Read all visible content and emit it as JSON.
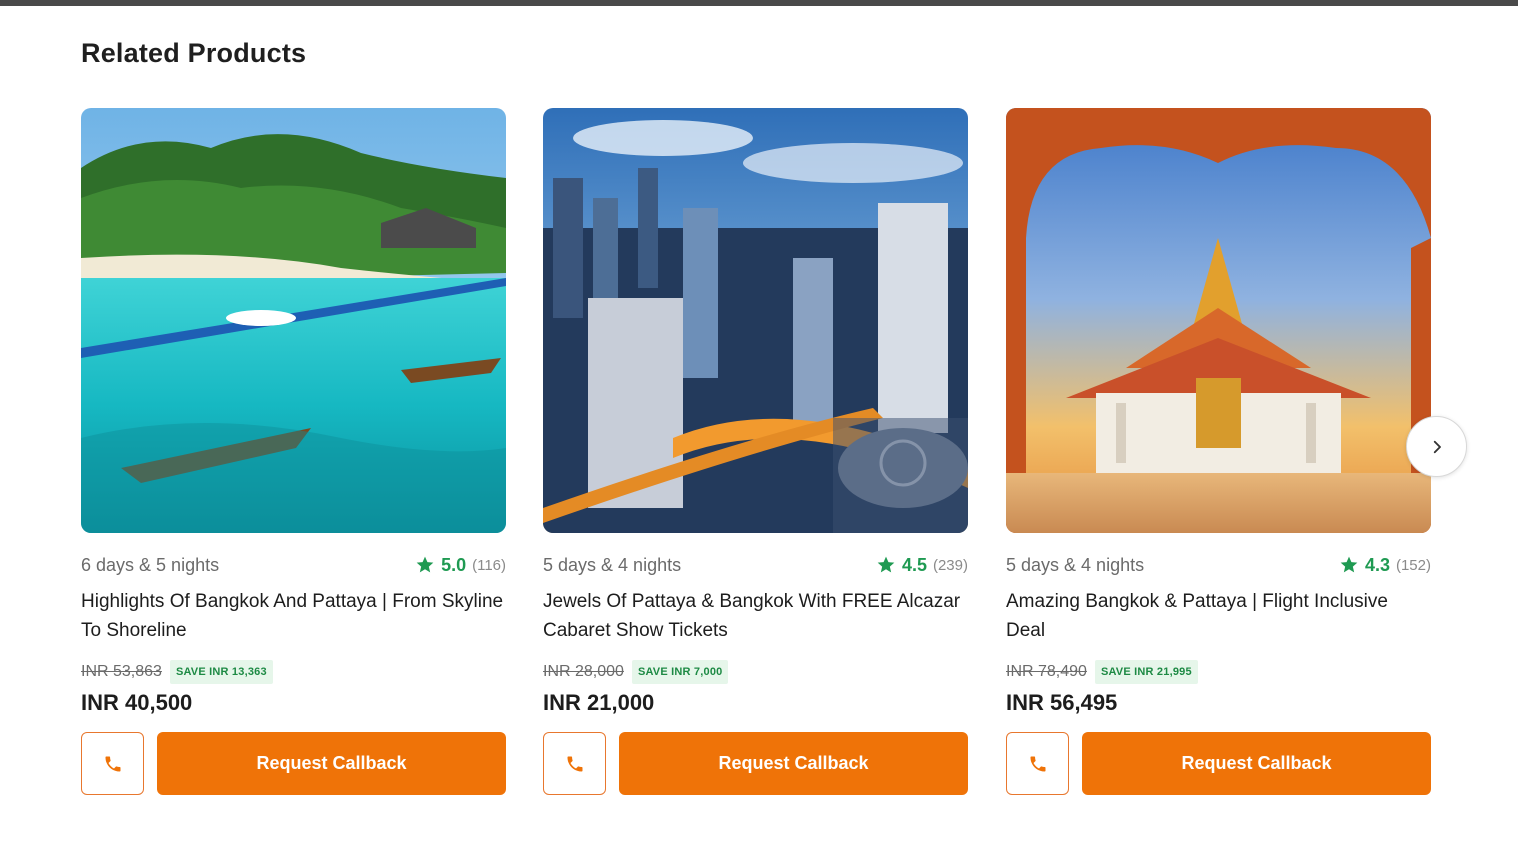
{
  "section": {
    "title": "Related Products"
  },
  "colors": {
    "accent": "#ef7308",
    "rating": "#1f9a52",
    "save_badge_bg": "#e6f6ea",
    "save_badge_text": "#1d8a44"
  },
  "products": [
    {
      "image": "tropical-island-beach-photo",
      "duration": "6 days & 5 nights",
      "rating": "5.0",
      "reviews": "(116)",
      "title": "Highlights Of Bangkok And Pattaya | From Skyline To Shoreline",
      "old_price": "INR 53,863",
      "save": "SAVE INR 13,363",
      "price": "INR 40,500",
      "call_icon": "phone-icon",
      "cta": "Request Callback"
    },
    {
      "image": "city-skyline-night-photo",
      "duration": "5 days & 4 nights",
      "rating": "4.5",
      "reviews": "(239)",
      "title": "Jewels Of Pattaya & Bangkok With FREE Alcazar Cabaret Show Tickets",
      "old_price": "INR 28,000",
      "save": "SAVE INR 7,000",
      "price": "INR 21,000",
      "call_icon": "phone-icon",
      "cta": "Request Callback"
    },
    {
      "image": "thai-temple-sunset-photo",
      "duration": "5 days & 4 nights",
      "rating": "4.3",
      "reviews": "(152)",
      "title": "Amazing Bangkok & Pattaya | Flight Inclusive Deal",
      "old_price": "INR 78,490",
      "save": "SAVE INR 21,995",
      "price": "INR 56,495",
      "call_icon": "phone-icon",
      "cta": "Request Callback"
    }
  ],
  "carousel": {
    "next_icon": "chevron-right-icon"
  }
}
